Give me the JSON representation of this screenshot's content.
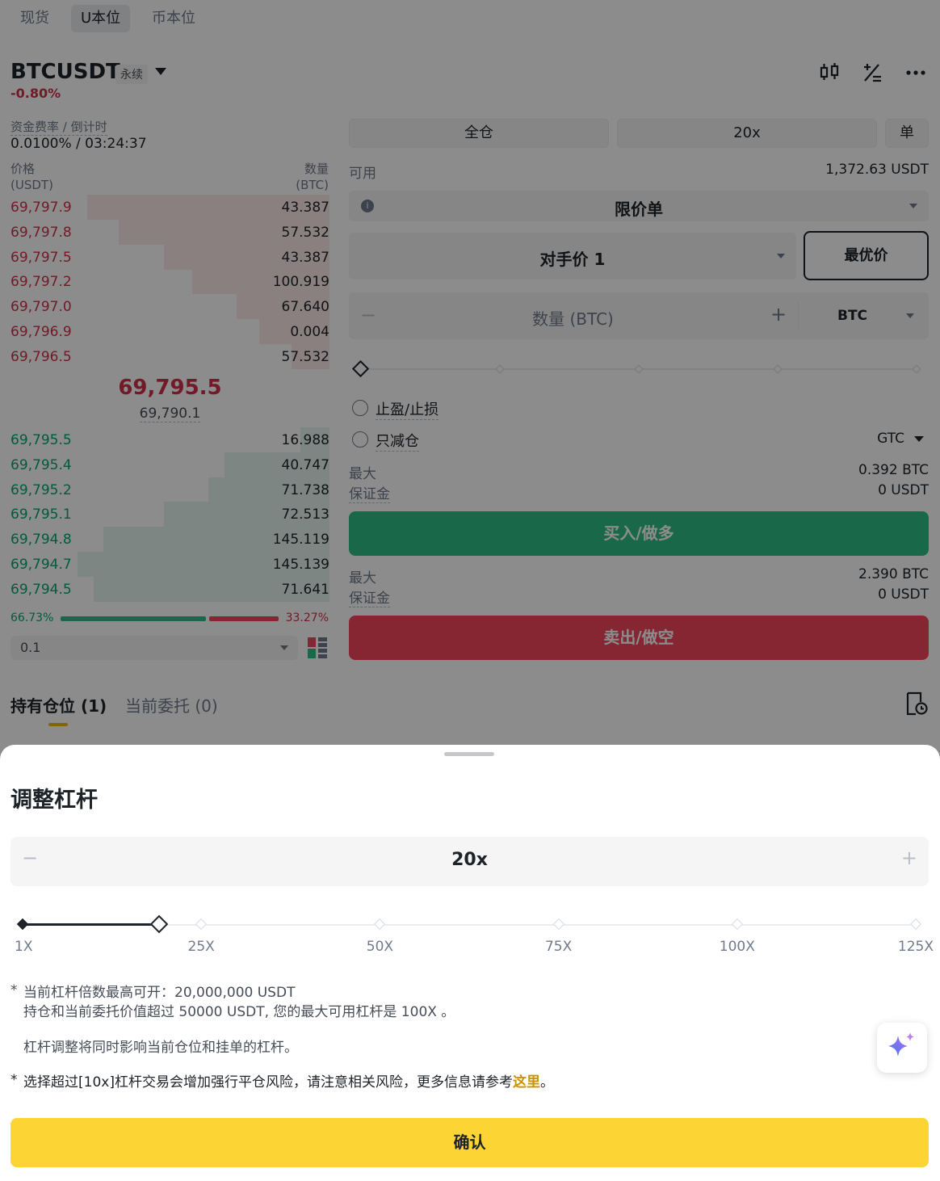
{
  "top_tabs": [
    "现货",
    "U本位",
    "币本位"
  ],
  "header": {
    "symbol": "BTCUSDT",
    "contract_type": "永续",
    "change_pct": "-0.80%",
    "funding_label": "资金费率 / 倒计时",
    "funding_value": "0.0100% / 03:24:37"
  },
  "orderbook": {
    "price_label": "价格",
    "price_unit": "(USDT)",
    "qty_label": "数量",
    "qty_unit": "(BTC)",
    "asks": [
      {
        "price": "69,797.9",
        "qty": "43.387",
        "depth": 0.76
      },
      {
        "price": "69,797.8",
        "qty": "57.532",
        "depth": 0.66
      },
      {
        "price": "69,797.5",
        "qty": "43.387",
        "depth": 0.52
      },
      {
        "price": "69,797.2",
        "qty": "100.919",
        "depth": 0.43
      },
      {
        "price": "69,797.0",
        "qty": "67.640",
        "depth": 0.29
      },
      {
        "price": "69,796.9",
        "qty": "0.004",
        "depth": 0.22
      },
      {
        "price": "69,796.5",
        "qty": "57.532",
        "depth": 0.12
      }
    ],
    "last_price": "69,795.5",
    "mark_price": "69,790.1",
    "bids": [
      {
        "price": "69,795.5",
        "qty": "16.988",
        "depth": 0.09
      },
      {
        "price": "69,795.4",
        "qty": "40.747",
        "depth": 0.33
      },
      {
        "price": "69,795.2",
        "qty": "71.738",
        "depth": 0.38
      },
      {
        "price": "69,795.1",
        "qty": "72.513",
        "depth": 0.52
      },
      {
        "price": "69,794.8",
        "qty": "145.119",
        "depth": 0.71
      },
      {
        "price": "69,794.7",
        "qty": "145.139",
        "depth": 0.79
      },
      {
        "price": "69,794.5",
        "qty": "71.641",
        "depth": 0.74
      }
    ],
    "buy_ratio": "66.73%",
    "sell_ratio": "33.27%",
    "buy_share": 0.667,
    "precision": "0.1"
  },
  "form": {
    "margin_mode": "全仓",
    "leverage": "20x",
    "position_mode": "单",
    "available_label": "可用",
    "available_value": "1,372.63 USDT",
    "order_type": "限价单",
    "price_type": "对手价 1",
    "best_price_btn": "最优价",
    "qty_placeholder": "数量 (BTC)",
    "qty_unit": "BTC",
    "tp_sl": "止盈/止损",
    "reduce_only": "只减仓",
    "tif": "GTC",
    "buy_max_label": "最大",
    "buy_max_value": "0.392 BTC",
    "buy_margin_label": "保证金",
    "buy_margin_value": "0 USDT",
    "buy_btn": "买入/做多",
    "sell_max_label": "最大",
    "sell_max_value": "2.390 BTC",
    "sell_margin_label": "保证金",
    "sell_margin_value": "0 USDT",
    "sell_btn": "卖出/做空"
  },
  "bottom_tabs": {
    "positions": "持有仓位 (1)",
    "orders": "当前委托 (0)"
  },
  "sheet": {
    "title": "调整杠杆",
    "leverage_value": "20x",
    "minus": "−",
    "plus": "+",
    "slider_labels": [
      "1X",
      "25X",
      "50X",
      "75X",
      "100X",
      "125X"
    ],
    "slider_fraction": 0.153,
    "note1_line1": "当前杠杆倍数最高可开：20,000,000 USDT",
    "note1_line2": "持仓和当前委托价值超过 50000 USDT, 您的最大可用杠杆是 100X 。",
    "note2": "杠杆调整将同时影响当前仓位和挂单的杠杆。",
    "warning_prefix": "选择超过[10x]杠杆交易会增加强行平仓风险，请注意相关风险，更多信息请参考",
    "warning_link": "这里",
    "warning_suffix": "。",
    "confirm_btn": "确认"
  },
  "colors": {
    "buy": "#2ebd85",
    "sell": "#f6465d",
    "accent": "#fcd535",
    "link": "#c99400"
  }
}
